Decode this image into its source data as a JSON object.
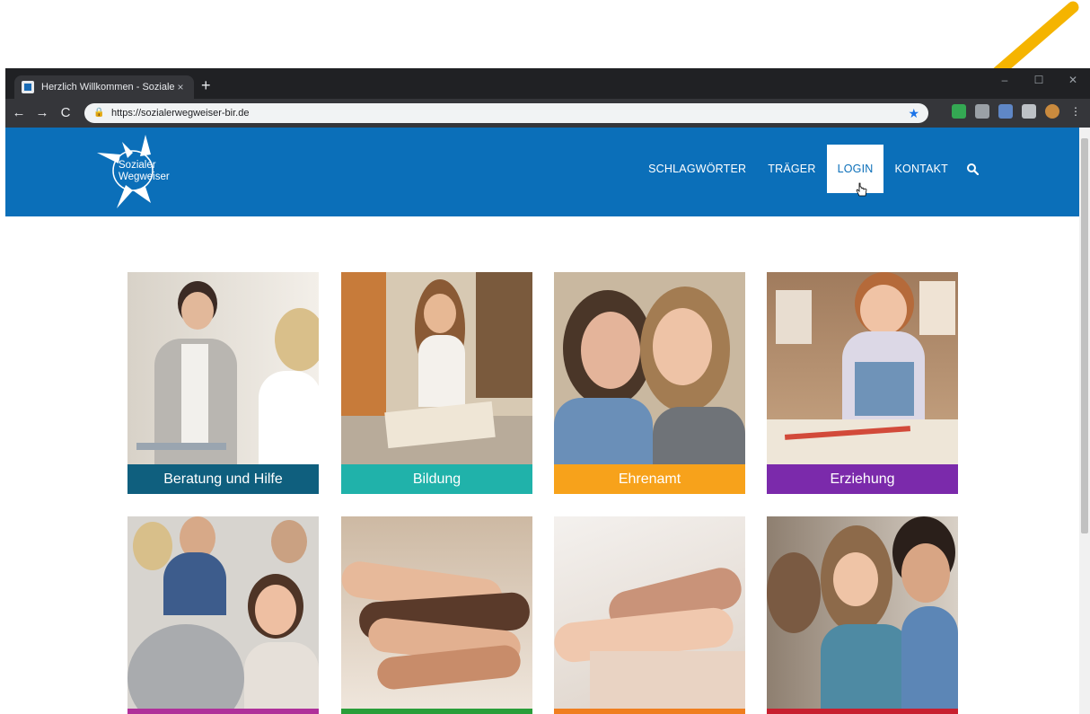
{
  "browser": {
    "tab_title": "Herzlich Willkommen - Sozialer W",
    "tab_close": "×",
    "new_tab": "+",
    "url": "https://sozialerwegweiser-bir.de",
    "window_controls": [
      "–",
      "☐",
      "✕"
    ],
    "nav_buttons": [
      "←",
      "→",
      "C"
    ]
  },
  "site": {
    "logo_line1": "Sozialer",
    "logo_line2": "Wegweiser",
    "nav": [
      "SCHLAGWÖRTER",
      "TRÄGER",
      "LOGIN",
      "KONTAKT"
    ],
    "active_nav": "LOGIN",
    "brand_color": "#0b6fb9"
  },
  "tiles": [
    {
      "label": "Beratung und Hilfe",
      "color": "#0f5f7e"
    },
    {
      "label": "Bildung",
      "color": "#20b2aa"
    },
    {
      "label": "Ehrenamt",
      "color": "#f7a21b"
    },
    {
      "label": "Erziehung",
      "color": "#7b2aab"
    },
    {
      "label": "",
      "color": "#b0309a"
    },
    {
      "label": "",
      "color": "#2a9e3a"
    },
    {
      "label": "",
      "color": "#f07e1f"
    },
    {
      "label": "",
      "color": "#c8202f"
    }
  ],
  "annotation": {
    "arrow_color": "#f5b400"
  }
}
